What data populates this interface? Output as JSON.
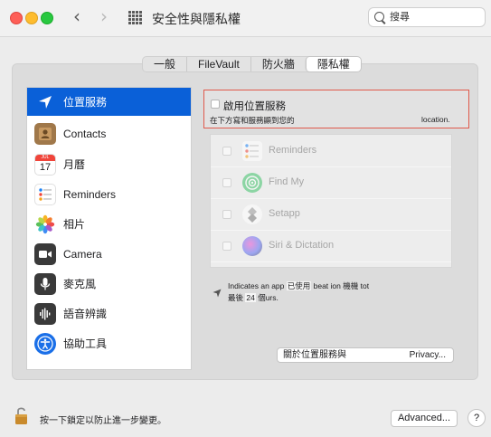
{
  "window": {
    "title": "安全性與隱私權",
    "back_glyph": "‹",
    "forward_glyph": "›"
  },
  "search": {
    "placeholder": "搜尋",
    "value": ""
  },
  "tabs": [
    {
      "label": "一般",
      "active": false
    },
    {
      "label": "FileVault",
      "active": false
    },
    {
      "label": "防火牆",
      "active": false
    },
    {
      "label": "隱私權",
      "active": true
    }
  ],
  "sidebar": {
    "items": [
      {
        "label": "位置服務",
        "icon": "location-arrow-icon",
        "selected": true
      },
      {
        "label": "Contacts",
        "icon": "contacts-icon",
        "selected": false
      },
      {
        "label": "月曆",
        "icon": "calendar-icon",
        "selected": false,
        "calendar_month": "JUL",
        "calendar_day": "17"
      },
      {
        "label": "Reminders",
        "icon": "reminders-icon",
        "selected": false
      },
      {
        "label": "相片",
        "icon": "photos-icon",
        "selected": false
      },
      {
        "label": "Camera",
        "icon": "camera-icon",
        "selected": false
      },
      {
        "label": "麥克風",
        "icon": "microphone-icon",
        "selected": false
      },
      {
        "label": "語音辨識",
        "icon": "speech-recognition-icon",
        "selected": false
      },
      {
        "label": "協助工具",
        "icon": "accessibility-icon",
        "selected": false
      }
    ]
  },
  "location": {
    "enable_label": "啟用位置服務",
    "enable_checked": false,
    "desc_left": "在下方寫和服務顯到您的",
    "desc_right": "location."
  },
  "apps": [
    {
      "name": "Reminders",
      "icon": "reminders-icon",
      "checked": false
    },
    {
      "name": "Find My",
      "icon": "find-my-icon",
      "checked": false
    },
    {
      "name": "Setapp",
      "icon": "setapp-icon",
      "checked": false
    },
    {
      "name": "Siri & Dictation",
      "icon": "siri-icon",
      "checked": false
    }
  ],
  "note": {
    "part1": "Indicates an app ",
    "part2": "已使用",
    "part3": " beat ion ",
    "part4": "機機 tot",
    "line2_a": "最後 ",
    "line2_b": "24",
    "line2_c": " 個urs."
  },
  "about_button": {
    "left": "關於位置服務與",
    "right": "Privacy..."
  },
  "footer": {
    "lock_text": "按一下鎖定以防止進一步變更。",
    "advanced_label": "Advanced...",
    "help_label": "?"
  },
  "colors": {
    "accent": "#0a60d8",
    "highlight_border": "#e05a4c",
    "close": "#fe5f57",
    "minimize": "#febc2e",
    "zoom": "#28c840"
  }
}
